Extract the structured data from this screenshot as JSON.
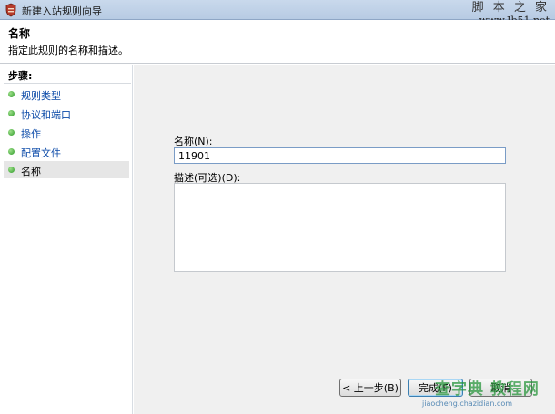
{
  "window": {
    "title": "新建入站规则向导"
  },
  "watermark_top": {
    "text": "脚 本 之 家",
    "url": "www.Jb51.net"
  },
  "header": {
    "title": "名称",
    "subtitle": "指定此规则的名称和描述。"
  },
  "sidebar": {
    "heading": "步骤:",
    "items": [
      {
        "label": "规则类型",
        "active": false
      },
      {
        "label": "协议和端口",
        "active": false
      },
      {
        "label": "操作",
        "active": false
      },
      {
        "label": "配置文件",
        "active": false
      },
      {
        "label": "名称",
        "active": true
      }
    ]
  },
  "form": {
    "name_label": "名称(N):",
    "name_value": "11901",
    "desc_label": "描述(可选)(D):",
    "desc_value": ""
  },
  "buttons": {
    "back": "< 上一步(B)",
    "finish": "完成(F)",
    "cancel": "取消"
  },
  "watermark_bottom": {
    "text": "查字典 教程网",
    "url": "jiaocheng.chazidian.com"
  },
  "colors": {
    "accent": "#0b4aa8",
    "step_dot": "#2f9a2a",
    "content_bg": "#f0f0f0"
  }
}
